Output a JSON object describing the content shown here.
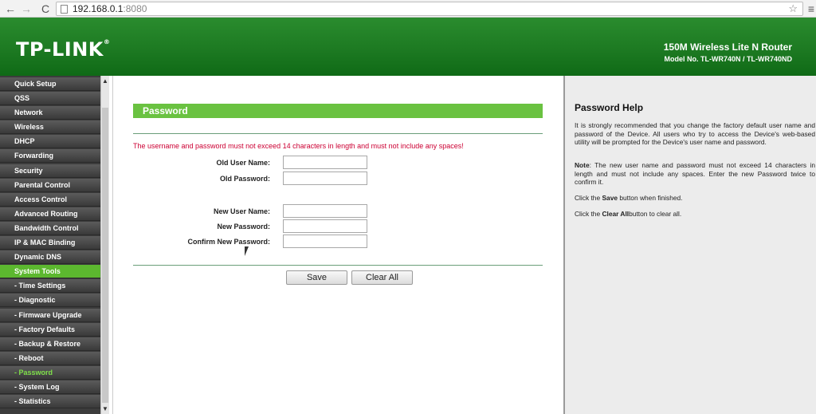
{
  "browser": {
    "url_host": "192.168.0.1",
    "url_port": ":8080",
    "back_icon": "←",
    "forward_icon": "→",
    "reload_icon": "C",
    "star_icon": "☆",
    "menu_icon": "≡"
  },
  "header": {
    "logo": "TP-LINK",
    "logo_reg": "®",
    "product_title": "150M Wireless Lite N Router",
    "model": "Model No. TL-WR740N / TL-WR740ND"
  },
  "sidebar": {
    "items": [
      {
        "label": "Quick Setup",
        "state": "normal"
      },
      {
        "label": "QSS",
        "state": "normal"
      },
      {
        "label": "Network",
        "state": "normal"
      },
      {
        "label": "Wireless",
        "state": "normal"
      },
      {
        "label": "DHCP",
        "state": "normal"
      },
      {
        "label": "Forwarding",
        "state": "normal"
      },
      {
        "label": "Security",
        "state": "normal"
      },
      {
        "label": "Parental Control",
        "state": "normal"
      },
      {
        "label": "Access Control",
        "state": "normal"
      },
      {
        "label": "Advanced Routing",
        "state": "normal"
      },
      {
        "label": "Bandwidth Control",
        "state": "normal"
      },
      {
        "label": "IP & MAC Binding",
        "state": "normal"
      },
      {
        "label": "Dynamic DNS",
        "state": "normal"
      },
      {
        "label": "System Tools",
        "state": "active"
      },
      {
        "label": "- Time Settings",
        "state": "sub"
      },
      {
        "label": "- Diagnostic",
        "state": "sub"
      },
      {
        "label": "- Firmware Upgrade",
        "state": "sub"
      },
      {
        "label": "- Factory Defaults",
        "state": "sub"
      },
      {
        "label": "- Backup & Restore",
        "state": "sub"
      },
      {
        "label": "- Reboot",
        "state": "sub"
      },
      {
        "label": "- Password",
        "state": "current"
      },
      {
        "label": "- System Log",
        "state": "sub"
      },
      {
        "label": "- Statistics",
        "state": "sub"
      }
    ]
  },
  "main": {
    "title": "Password",
    "warning": "The username and password must not exceed 14 characters in length and must not include any spaces!",
    "fields": {
      "old_user": {
        "label": "Old User Name:",
        "value": ""
      },
      "old_pass": {
        "label": "Old Password:",
        "value": ""
      },
      "new_user": {
        "label": "New User Name:",
        "value": ""
      },
      "new_pass": {
        "label": "New Password:",
        "value": ""
      },
      "confirm_pass": {
        "label": "Confirm New Password:",
        "value": ""
      }
    },
    "save_label": "Save",
    "clear_label": "Clear All"
  },
  "help": {
    "title": "Password Help",
    "p1": "It is strongly recommended that you change the factory default user name and password of the Device. All users who try to access the Device's web-based utility will be prompted for the Device's user name and password.",
    "p2_bold": "Note",
    "p2": ": The new user name and password must not exceed 14 characters in length and must not include any spaces. Enter the new Password twice to confirm it.",
    "p3_pre": "Click the ",
    "p3_bold": "Save",
    "p3_post": " button when finished.",
    "p4_pre": "Click the ",
    "p4_bold": "Clear All",
    "p4_post": "button to clear all."
  }
}
